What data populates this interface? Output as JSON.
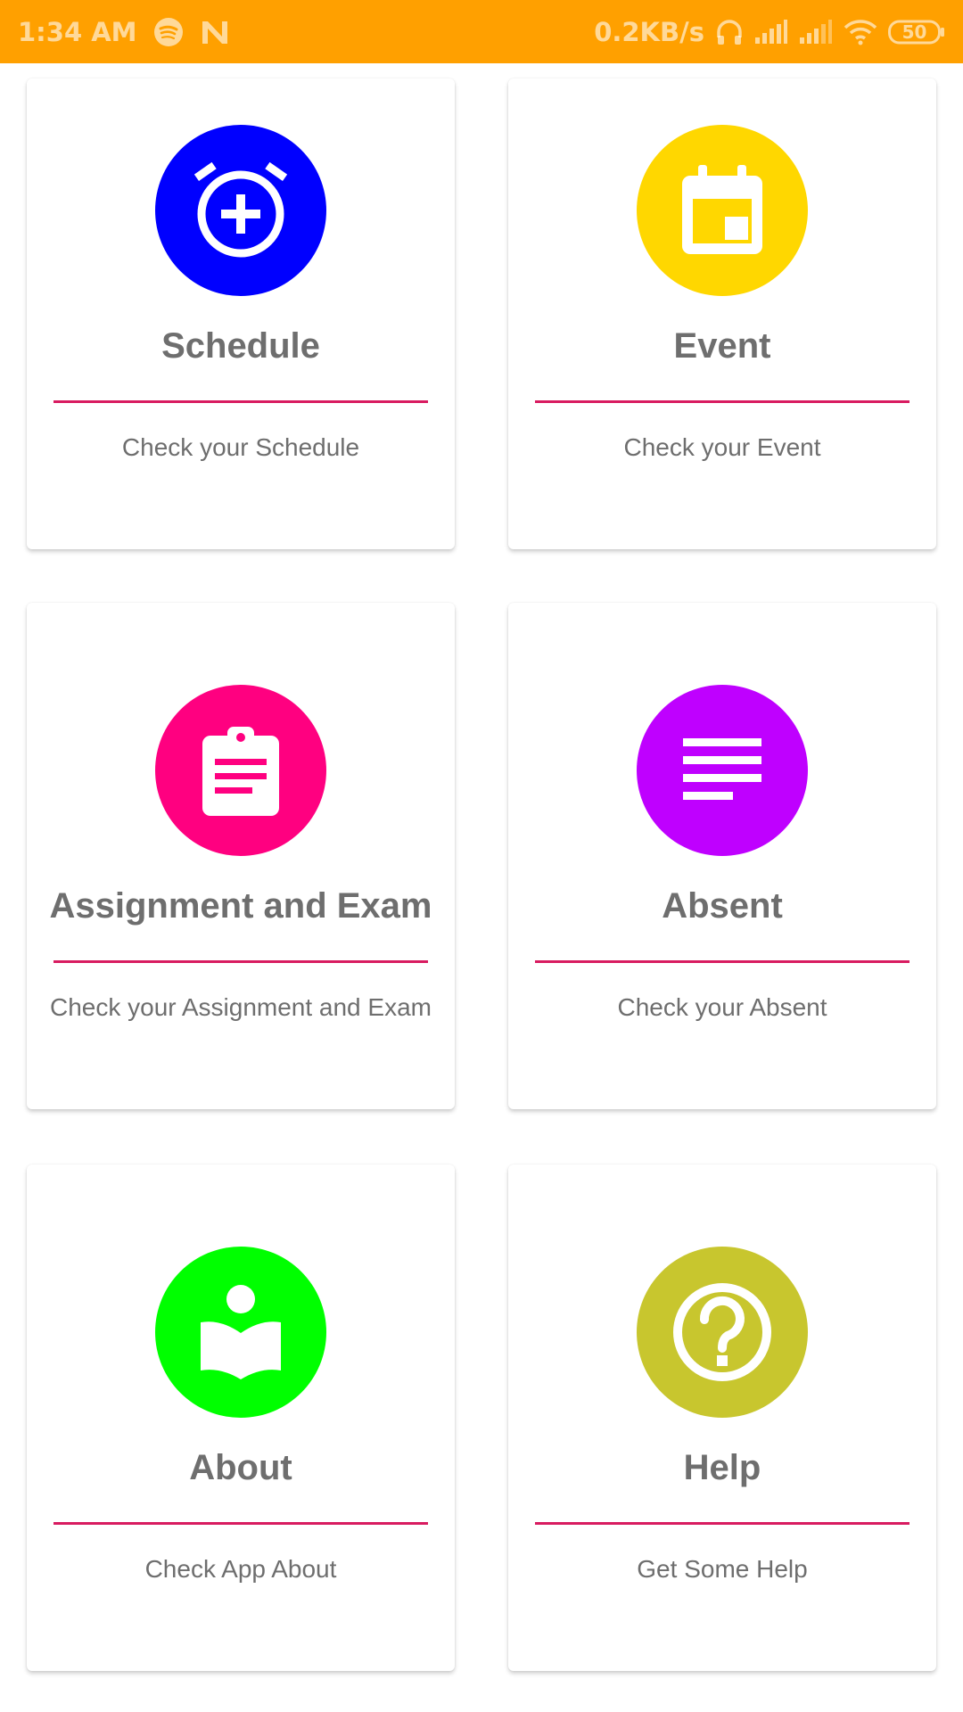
{
  "status_bar": {
    "time": "1:34 AM",
    "net_speed": "0.2KB/s",
    "battery": "50",
    "icons": [
      "spotify-icon",
      "n-notification-icon",
      "headset-icon",
      "signal-icon",
      "signal-icon",
      "wifi-icon",
      "battery-icon"
    ]
  },
  "cards": [
    {
      "title": "Schedule",
      "subtitle": "Check your Schedule",
      "icon": "alarm-add-icon",
      "color": "#0000FF"
    },
    {
      "title": "Event",
      "subtitle": "Check your Event",
      "icon": "calendar-event-icon",
      "color": "#FFD700"
    },
    {
      "title": "Assignment and Exam",
      "subtitle": "Check your Assignment and Exam",
      "icon": "clipboard-icon",
      "color": "#FF0080"
    },
    {
      "title": "Absent",
      "subtitle": "Check your Absent",
      "icon": "notes-icon",
      "color": "#BF00FF"
    },
    {
      "title": "About",
      "subtitle": "Check App About",
      "icon": "reader-book-icon",
      "color": "#00FF00"
    },
    {
      "title": "Help",
      "subtitle": "Get Some Help",
      "icon": "help-circle-icon",
      "color": "#C8C62E"
    }
  ],
  "colors": {
    "status_bar": "#FFA000",
    "divider": "#D81B60",
    "text": "#6E6E6E"
  }
}
